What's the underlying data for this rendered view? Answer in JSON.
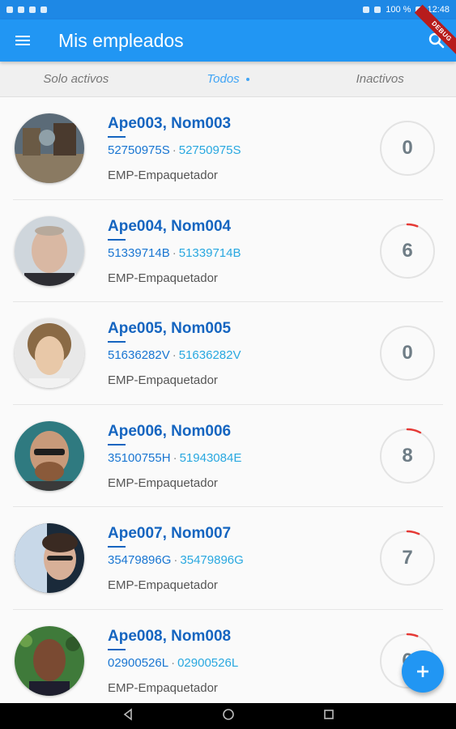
{
  "status_bar": {
    "battery": "100 %",
    "time": "12:48"
  },
  "app_bar": {
    "title": "Mis empleados",
    "debug_label": "DEBUG"
  },
  "tabs": [
    {
      "label": "Solo activos",
      "active": false
    },
    {
      "label": "Todos",
      "active": true
    },
    {
      "label": "Inactivos",
      "active": false
    }
  ],
  "employees": [
    {
      "name": "Ape003, Nom003",
      "id1": "52750975S",
      "id2": "52750975S",
      "role": "EMP-Empaquetador",
      "count": "0",
      "progress": 0
    },
    {
      "name": "Ape004, Nom004",
      "id1": "51339714B",
      "id2": "51339714B",
      "role": "EMP-Empaquetador",
      "count": "6",
      "progress": 0.06
    },
    {
      "name": "Ape005, Nom005",
      "id1": "51636282V",
      "id2": "51636282V",
      "role": "EMP-Empaquetador",
      "count": "0",
      "progress": 0
    },
    {
      "name": "Ape006, Nom006",
      "id1": "35100755H",
      "id2": "51943084E",
      "role": "EMP-Empaquetador",
      "count": "8",
      "progress": 0.08
    },
    {
      "name": "Ape007, Nom007",
      "id1": "35479896G",
      "id2": "35479896G",
      "role": "EMP-Empaquetador",
      "count": "7",
      "progress": 0.07
    },
    {
      "name": "Ape008, Nom008",
      "id1": "02900526L",
      "id2": "02900526L",
      "role": "EMP-Empaquetador",
      "count": "6",
      "progress": 0.06
    }
  ],
  "separator": "·",
  "colors": {
    "primary": "#2196f3",
    "name": "#1565c0",
    "id_secondary": "#29a8e0",
    "progress_arc": "#e53935"
  },
  "icons": {
    "menu": "menu-icon",
    "search": "search-icon",
    "add": "add-icon",
    "back": "back-icon",
    "home": "home-icon",
    "recents": "recents-icon"
  }
}
